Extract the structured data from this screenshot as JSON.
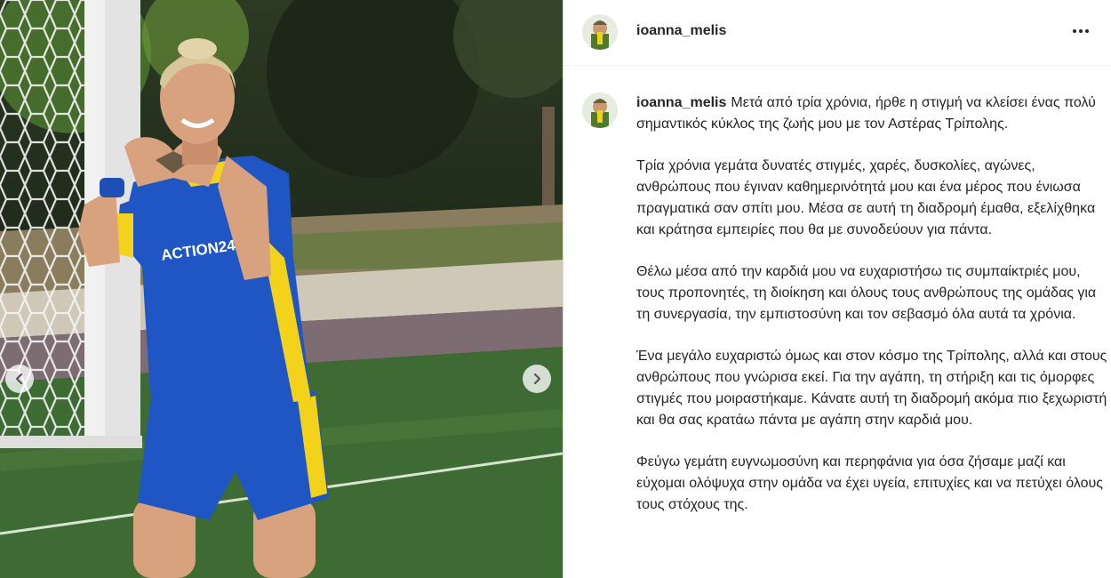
{
  "post": {
    "username": "ioanna_melis",
    "more_icon": "more-horizontal-icon",
    "media": {
      "jersey_text": "ACTION24",
      "prev_icon": "chevron-left-icon",
      "next_icon": "chevron-right-icon"
    },
    "caption": {
      "username": "ioanna_melis",
      "paragraphs": [
        "Μετά από τρία χρόνια, ήρθε η στιγμή να κλείσει ένας πολύ σημαντικός κύκλος της ζωής μου με τον Αστέρας Τρίπολης.",
        "Τρία χρόνια γεμάτα δυνατές στιγμές, χαρές, δυσκολίες, αγώνες, ανθρώπους που έγιναν καθημερινότητά μου και ένα μέρος που ένιωσα πραγματικά σαν σπίτι μου. Μέσα σε αυτή τη διαδρομή έμαθα, εξελίχθηκα και κράτησα εμπειρίες που θα με συνοδεύουν για πάντα.",
        "Θέλω μέσα από την καρδιά μου να ευχαριστήσω τις συμπαίκτριές μου, τους προπονητές, τη διοίκηση και όλους τους ανθρώπους της ομάδας για τη συνεργασία, την εμπιστοσύνη και τον σεβασμό όλα αυτά τα χρόνια.",
        "Ένα μεγάλο ευχαριστώ όμως και στον κόσμο της Τρίπολης, αλλά και στους ανθρώπους που γνώρισα εκεί. Για την αγάπη, τη στήριξη και τις όμορφες στιγμές που μοιραστήκαμε. Κάνατε αυτή τη διαδρομή ακόμα πιο ξεχωριστή και θα σας κρατάω πάντα με αγάπη στην καρδιά μου.",
        "Φεύγω γεμάτη ευγνωμοσύνη και περηφάνια για όσα ζήσαμε μαζί και εύχομαι ολόψυχα στην ομάδα να έχει υγεία, επιτυχίες και να πετύχει όλους τους στόχους της."
      ]
    }
  },
  "colors": {
    "jersey_blue": "#1f56c4",
    "jersey_yellow": "#f2d21b",
    "pitch_green": "#3d6b33",
    "text": "#262626"
  }
}
